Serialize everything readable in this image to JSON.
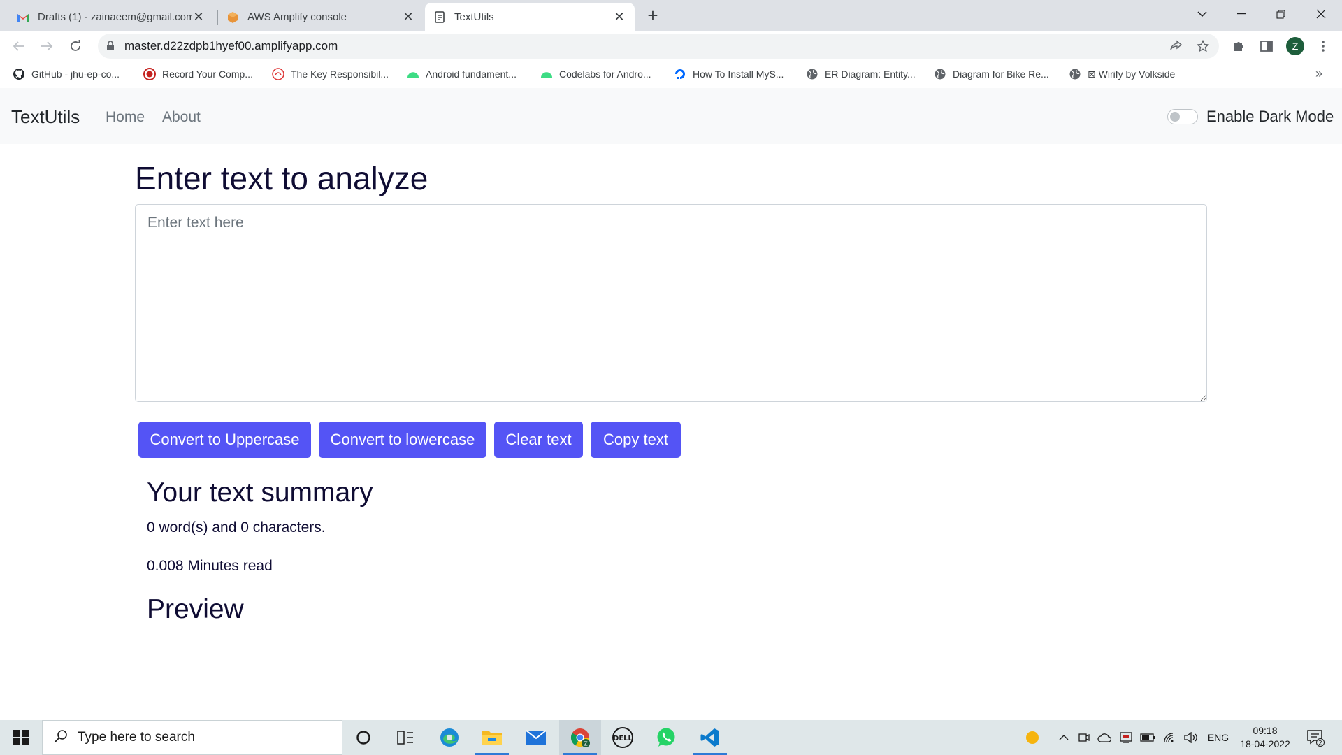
{
  "browser": {
    "tabs": [
      {
        "title": "Drafts (1) - zainaeem@gmail.com",
        "icon": "gmail-icon"
      },
      {
        "title": "AWS Amplify console",
        "icon": "aws-icon"
      },
      {
        "title": "TextUtils",
        "icon": "document-icon"
      }
    ],
    "url": "master.d22zdpb1hyef00.amplifyapp.com",
    "profile_initial": "Z",
    "bookmarks": [
      {
        "label": "GitHub - jhu-ep-co...",
        "icon": "github-icon"
      },
      {
        "label": "Record Your Comp...",
        "icon": "record-icon"
      },
      {
        "label": "The Key Responsibil...",
        "icon": "site-icon"
      },
      {
        "label": "Android fundament...",
        "icon": "android-icon"
      },
      {
        "label": "Codelabs for Andro...",
        "icon": "android-icon"
      },
      {
        "label": "How To Install MyS...",
        "icon": "digitalocean-icon"
      },
      {
        "label": "ER Diagram: Entity...",
        "icon": "globe-icon"
      },
      {
        "label": "Diagram for Bike Re...",
        "icon": "globe-icon"
      },
      {
        "label": "⊠ Wirify by Volkside",
        "icon": "globe-icon"
      }
    ]
  },
  "app": {
    "brand": "TextUtils",
    "nav": {
      "home": "Home",
      "about": "About"
    },
    "dark_mode_label": "Enable Dark Mode",
    "dark_mode_on": false,
    "heading": "Enter text to analyze",
    "textarea": {
      "value": "",
      "placeholder": "Enter text here"
    },
    "buttons": {
      "uppercase": "Convert to Uppercase",
      "lowercase": "Convert to lowercase",
      "clear": "Clear text",
      "copy": "Copy text"
    },
    "summary": {
      "heading": "Your text summary",
      "counts": "0 word(s) and 0 characters.",
      "read_time": "0.008 Minutes read"
    },
    "preview_heading": "Preview",
    "accent_color": "#5454f5"
  },
  "taskbar": {
    "search_placeholder": "Type here to search",
    "language": "ENG",
    "time": "09:18",
    "date": "18-04-2022",
    "notification_count": "2"
  }
}
